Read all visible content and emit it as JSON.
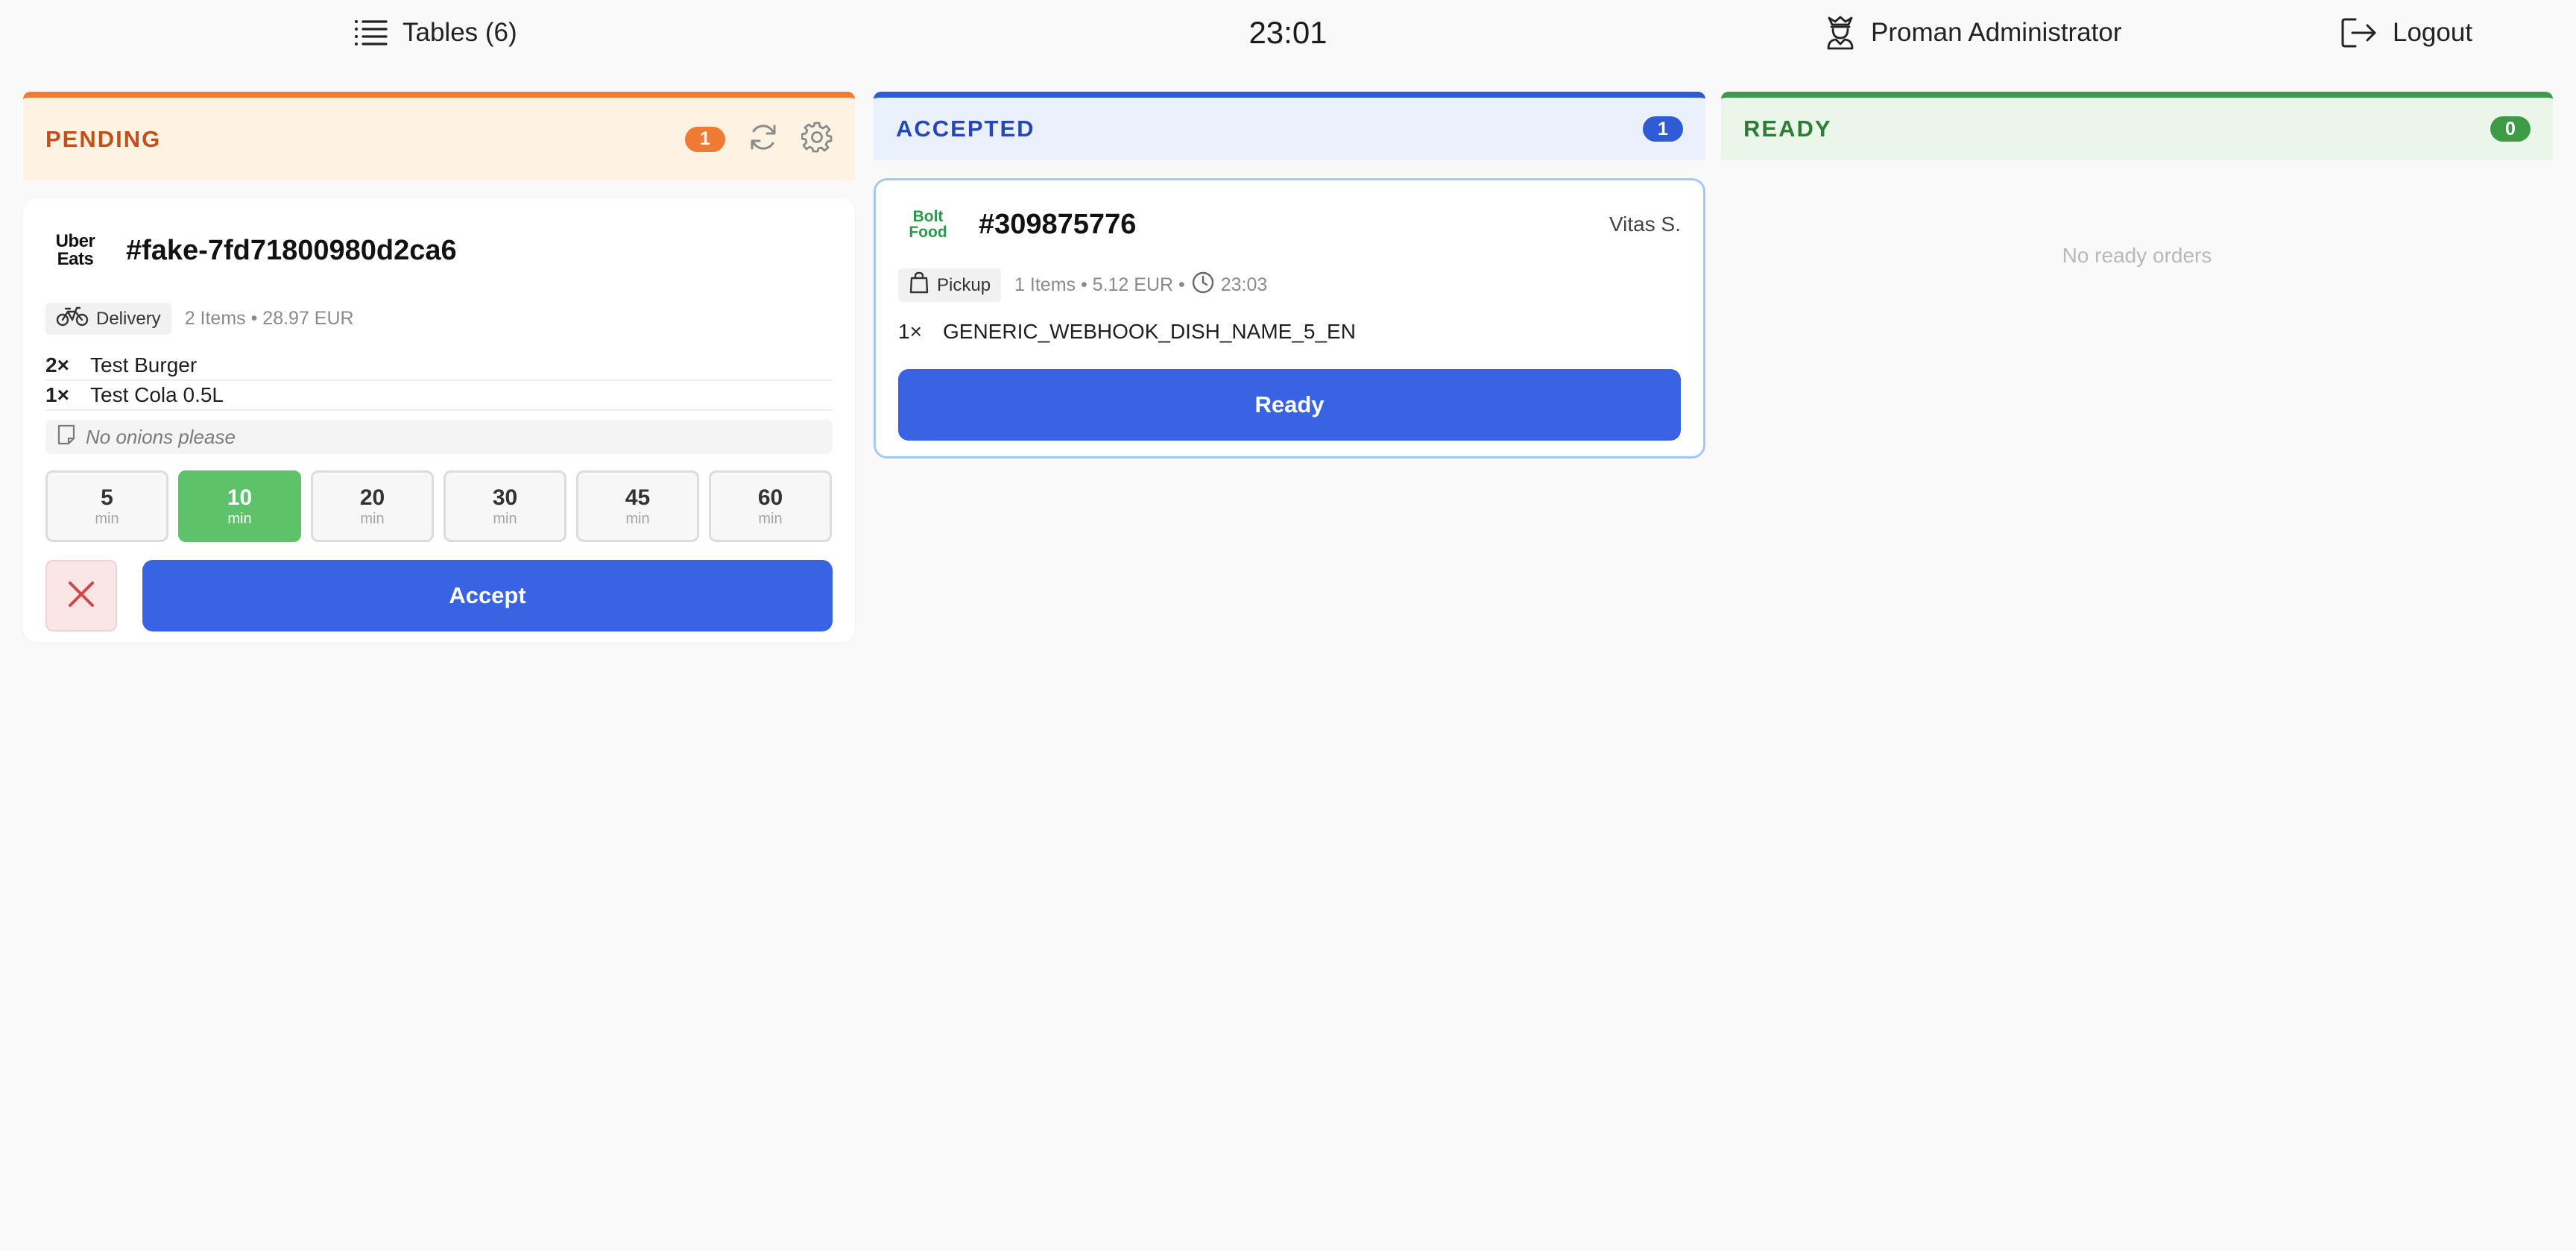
{
  "topbar": {
    "tables_label": "Tables (6)",
    "clock": "23:01",
    "user_name": "Proman Administrator",
    "logout_label": "Logout"
  },
  "columns": {
    "pending": {
      "title": "PENDING",
      "count": "1"
    },
    "accepted": {
      "title": "ACCEPTED",
      "count": "1"
    },
    "ready": {
      "title": "READY",
      "count": "0",
      "empty_text": "No ready orders"
    }
  },
  "pending_order": {
    "provider_logo": {
      "line1": "Uber",
      "line2": "Eats"
    },
    "order_id": "#fake-7fd71800980d2ca6",
    "type_label": "Delivery",
    "summary": "2 Items • 28.97 EUR",
    "items": [
      {
        "qty": "2×",
        "name": "Test Burger"
      },
      {
        "qty": "1×",
        "name": "Test Cola 0.5L"
      }
    ],
    "note": "No onions please",
    "prep_times": [
      {
        "value": "5",
        "unit": "min",
        "selected": false
      },
      {
        "value": "10",
        "unit": "min",
        "selected": true
      },
      {
        "value": "20",
        "unit": "min",
        "selected": false
      },
      {
        "value": "30",
        "unit": "min",
        "selected": false
      },
      {
        "value": "45",
        "unit": "min",
        "selected": false
      },
      {
        "value": "60",
        "unit": "min",
        "selected": false
      }
    ],
    "accept_label": "Accept"
  },
  "accepted_order": {
    "provider_logo": {
      "line1": "Bolt",
      "line2": "Food"
    },
    "order_id": "#309875776",
    "customer": "Vitas S.",
    "type_label": "Pickup",
    "summary": "1 Items • 5.12 EUR •",
    "pickup_time": "23:03",
    "items": [
      {
        "qty": "1×",
        "name": "GENERIC_WEBHOOK_DISH_NAME_5_EN"
      }
    ],
    "ready_label": "Ready"
  },
  "colors": {
    "pending_accent": "#f07c38",
    "accepted_accent": "#2f5bd5",
    "ready_accent": "#3d9a47",
    "primary_button": "#3863e3",
    "selected_time": "#5ec26a",
    "reject_icon": "#d64545"
  },
  "icons": {
    "tables": "list-icon",
    "user": "chef-icon",
    "logout": "logout-icon",
    "refresh": "refresh-icon",
    "settings": "gear-icon",
    "delivery": "bicycle-icon",
    "pickup": "bag-icon",
    "clock": "clock-icon",
    "note": "note-icon",
    "reject": "close-icon"
  }
}
